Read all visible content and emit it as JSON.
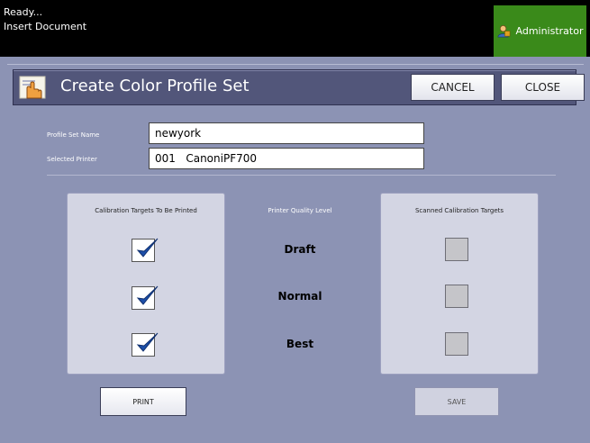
{
  "status": {
    "line1": "Ready...",
    "line2": "Insert Document"
  },
  "user": {
    "label": "Administrator",
    "icon": "admin-user-icon"
  },
  "dialog": {
    "title": "Create Color Profile Set",
    "title_icon": "hand-pointer-icon",
    "cancel_label": "CANCEL",
    "close_label": "CLOSE"
  },
  "fields": {
    "profile_set_name_label": "Profile Set Name",
    "profile_set_name_value": "newyork",
    "selected_printer_label": "Selected Printer",
    "selected_printer_value": "001   CanoniPF700"
  },
  "columns": {
    "calibration_title": "Calibration Targets To Be Printed",
    "quality_title": "Printer Quality Level",
    "scanned_title": "Scanned Calibration Targets"
  },
  "levels": [
    {
      "name": "Draft",
      "print_checked": true,
      "scanned": false
    },
    {
      "name": "Normal",
      "print_checked": true,
      "scanned": false
    },
    {
      "name": "Best",
      "print_checked": true,
      "scanned": false
    }
  ],
  "actions": {
    "print_label": "PRINT",
    "save_label": "SAVE"
  },
  "colors": {
    "background": "#8c93b4",
    "title_bar": "#52567a",
    "admin_green": "#3a8a1a",
    "check_blue": "#1d4fa8"
  }
}
